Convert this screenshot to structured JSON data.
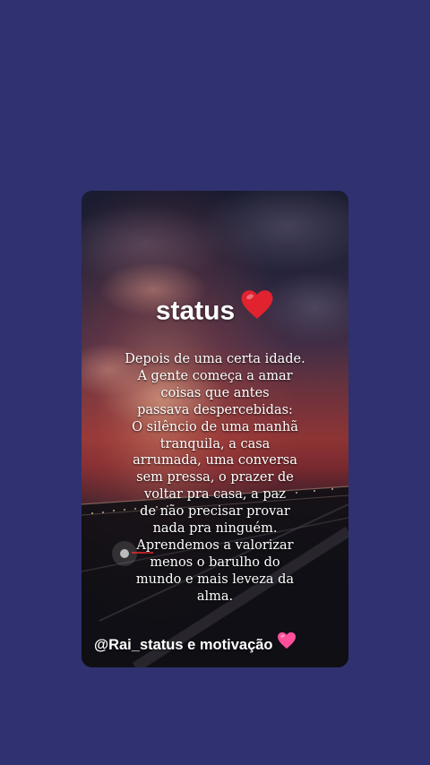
{
  "colors": {
    "page_background": "#2f3170",
    "text": "#ffffff",
    "heart_red": "#e0232f",
    "heart_pink": "#ff4f9a"
  },
  "post": {
    "title": "status",
    "title_emoji_icon": "red-heart-icon",
    "message_lines": [
      "Depois de uma certa idade.",
      "A gente começa a amar",
      "coisas que antes",
      "passava despercebidas:",
      "O silêncio de uma manhã",
      "tranquila, a casa",
      "arrumada, uma conversa",
      "sem pressa, o prazer de",
      "voltar pra casa, a paz",
      "de não precisar provar",
      "nada pra ninguém.",
      "Aprendemos a valorizar",
      "menos o barulho do",
      "mundo e mais leveza da",
      "alma."
    ],
    "footer": "@Rai_status e motivação",
    "footer_emoji_icon": "pink-heart-icon"
  }
}
